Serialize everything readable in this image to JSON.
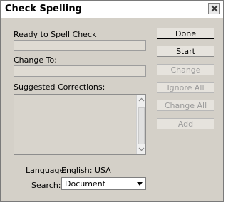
{
  "window": {
    "title": "Check Spelling"
  },
  "ready_label": "Ready to Spell Check",
  "change_to_label": "Change To:",
  "suggested_label": "Suggested Corrections:",
  "language": {
    "label": "Language:",
    "value": "English: USA"
  },
  "search": {
    "label": "Search:",
    "value": "Document"
  },
  "buttons": {
    "done": "Done",
    "start": "Start",
    "change": "Change",
    "ignore_all": "Ignore All",
    "change_all": "Change All",
    "add": "Add"
  },
  "icons": [
    "close-icon",
    "scroll-up-icon",
    "scroll-down-icon",
    "chevron-down-icon"
  ]
}
